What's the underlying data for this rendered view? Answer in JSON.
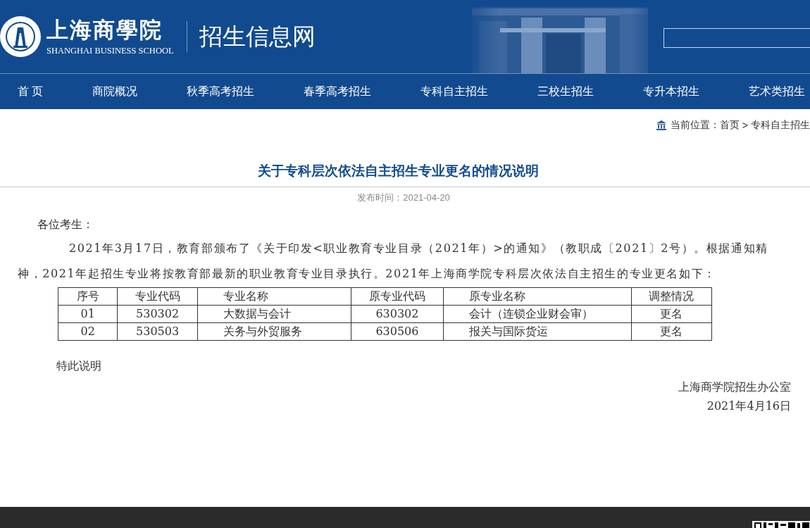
{
  "header": {
    "school_name": "上海商學院",
    "school_name_en": "SHANGHAI BUSINESS SCHOOL",
    "site_title": "招生信息网"
  },
  "nav": [
    {
      "label": "首 页"
    },
    {
      "label": "商院概况"
    },
    {
      "label": "秋季高考招生"
    },
    {
      "label": "春季高考招生"
    },
    {
      "label": "专科自主招生"
    },
    {
      "label": "三校生招生"
    },
    {
      "label": "专升本招生"
    },
    {
      "label": "艺术类招生"
    }
  ],
  "breadcrumb": {
    "prefix": "当前位置：",
    "items": [
      {
        "label": "首页"
      },
      {
        "label": "专科自主招生"
      }
    ],
    "separator": ">"
  },
  "article": {
    "title": "关于专科层次依法自主招生专业更名的情况说明",
    "published": "发布时间：2021-04-20",
    "greeting": "各位考生：",
    "paragraph": "2021年3月17日，教育部颁布了《关于印发<职业教育专业目录（2021年）>的通知》（教职成〔2021〕2号）。根据通知精神，2021年起招生专业将按教育部最新的职业教育专业目录执行。2021年上海商学院专科层次依法自主招生的专业更名如下：",
    "table": {
      "columns": [
        "序号",
        "专业代码",
        "专业名称",
        "原专业代码",
        "原专业名称",
        "调整情况"
      ],
      "rows": [
        [
          "01",
          "530302",
          "大数据与会计",
          "630302",
          "会计（连锁企业财会审）",
          "更名"
        ],
        [
          "02",
          "530503",
          "关务与外贸服务",
          "630506",
          "报关与国际货运",
          "更名"
        ]
      ]
    },
    "closing": "特此说明",
    "signature": "上海商学院招生办公室",
    "date": "2021年4月16日"
  }
}
